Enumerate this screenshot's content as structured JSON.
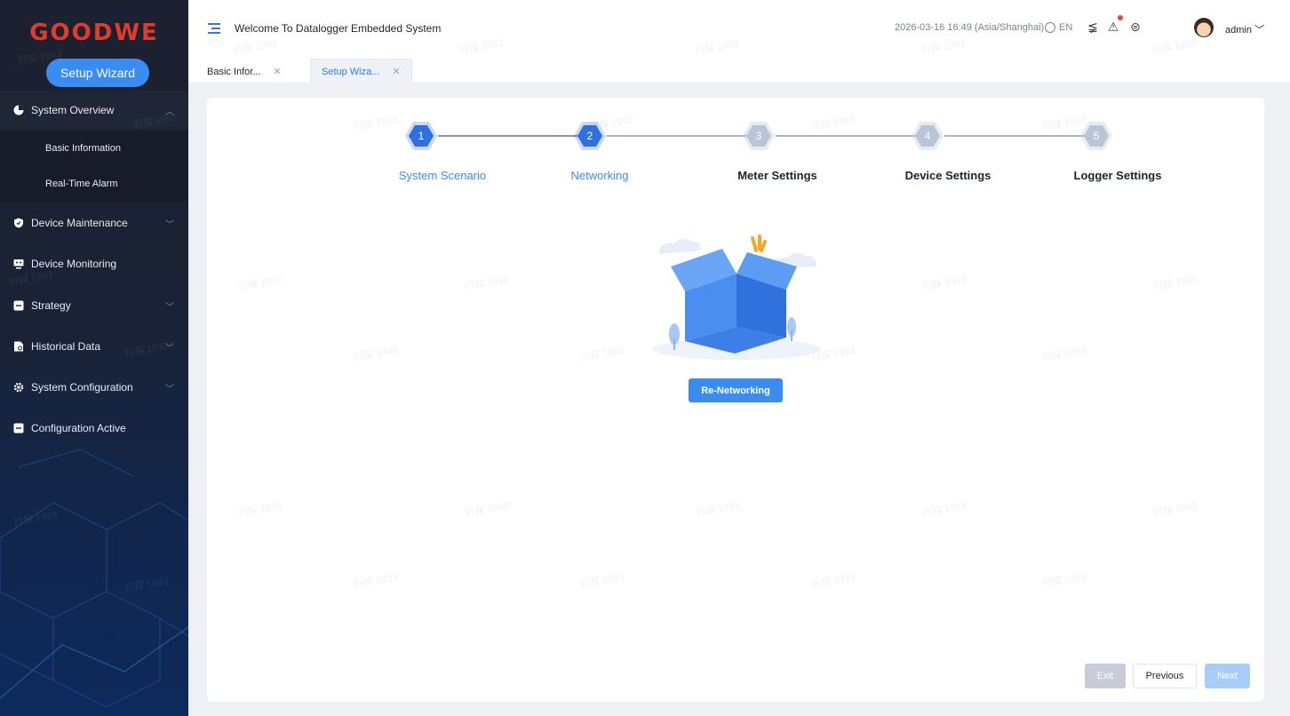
{
  "brand": {
    "logo_text": "GOODWE",
    "logo_color": "#e23a2b"
  },
  "sidebar": {
    "wizard_button": "Setup Wizard",
    "items": [
      {
        "label": "System Overview",
        "icon": "pie-chart-icon",
        "expanded": true
      },
      {
        "label": "Device Maintenance",
        "icon": "shield-icon",
        "expanded": false
      },
      {
        "label": "Device Monitoring",
        "icon": "monitor-icon",
        "expanded": false
      },
      {
        "label": "Strategy",
        "icon": "strategy-icon",
        "expanded": false
      },
      {
        "label": "Historical Data",
        "icon": "history-icon",
        "expanded": false
      },
      {
        "label": "System Configuration",
        "icon": "gear-icon",
        "expanded": false
      },
      {
        "label": "Configuration Active",
        "icon": "config-icon",
        "expanded": false
      }
    ],
    "sub_items": [
      {
        "label": "Basic Information"
      },
      {
        "label": "Real-Time Alarm"
      }
    ]
  },
  "header": {
    "title": "Welcome To Datalogger Embedded System",
    "datetime": "2026-03-16 16:49 (Asia/Shanghai)",
    "language": "EN",
    "user": "admin"
  },
  "tabs": [
    {
      "label": "Basic Infor...",
      "active": false
    },
    {
      "label": "Setup Wiza...",
      "active": true
    }
  ],
  "wizard": {
    "steps": [
      {
        "num": "1",
        "label": "System Scenario",
        "state": "done"
      },
      {
        "num": "2",
        "label": "Networking",
        "state": "current"
      },
      {
        "num": "3",
        "label": "Meter Settings",
        "state": "todo"
      },
      {
        "num": "4",
        "label": "Device Settings",
        "state": "todo"
      },
      {
        "num": "5",
        "label": "Logger Settings",
        "state": "todo"
      }
    ],
    "action_button": "Re-Networking",
    "footer": {
      "exit": "Exit",
      "previous": "Previous",
      "next": "Next"
    }
  },
  "watermark": "行探 1993",
  "colors": {
    "accent": "#3b8cf0",
    "step_done": "#2f6fe0",
    "step_todo": "#b9c6d9"
  }
}
